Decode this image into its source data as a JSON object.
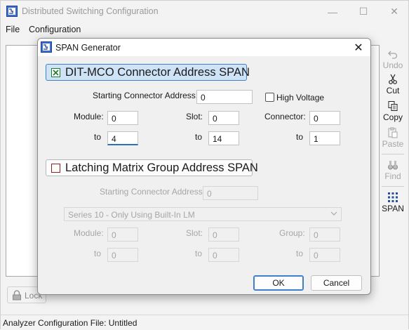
{
  "window": {
    "title": "Distributed Switching Configuration",
    "minimize_glyph": "—",
    "maximize_glyph": "☐",
    "close_glyph": "✕"
  },
  "menu": [
    "File",
    "Configuration"
  ],
  "toolbar": {
    "undo": "Undo",
    "cut": "Cut",
    "copy": "Copy",
    "paste": "Paste",
    "find": "Find",
    "span": "SPAN"
  },
  "lock_label": "Lock",
  "status": "Analyzer Configuration File: Untitled",
  "dialog": {
    "title": "SPAN Generator",
    "close_glyph": "✕",
    "section1": {
      "label": "DIT-MCO Connector Address SPAN",
      "starting_label": "Starting Connector Address:",
      "starting_value": "0",
      "high_voltage_label": "High Voltage",
      "module_label": "Module:",
      "slot_label": "Slot:",
      "connector_label": "Connector:",
      "to_label": "to",
      "module_from": "0",
      "module_to": "4",
      "slot_from": "0",
      "slot_to": "14",
      "connector_from": "0",
      "connector_to": "1"
    },
    "section2": {
      "label": "Latching Matrix Group Address SPAN",
      "starting_label": "Starting Connector Address:",
      "starting_value": "0",
      "series_value": "Series 10 - Only Using Built-In LM",
      "module_label": "Module:",
      "slot_label": "Slot:",
      "group_label": "Group:",
      "to_label": "to",
      "module_from": "0",
      "module_to": "0",
      "slot_from": "0",
      "slot_to": "0",
      "group_from": "0",
      "group_to": "0"
    },
    "ok_label": "OK",
    "cancel_label": "Cancel"
  },
  "colors": {
    "accent": "#3d7fc9",
    "checked_green": "#1b7a2b",
    "unchecked_red": "#9a1c1c",
    "disabled_text": "#a6a6a6"
  }
}
